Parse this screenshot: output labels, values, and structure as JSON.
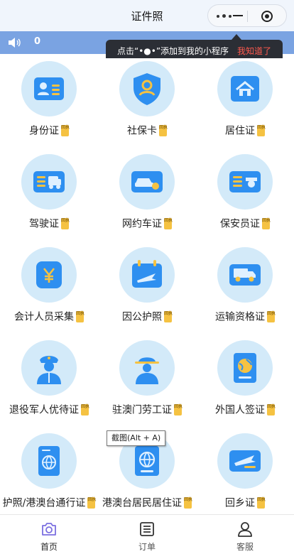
{
  "nav": {
    "title": "证件照"
  },
  "notice": {
    "count": "0"
  },
  "tooltip": {
    "message": "点击“•●•”添加到我的小程序",
    "dismiss": "我知道了"
  },
  "colors": {
    "accent": "#2e8ff0",
    "badge": "#f5c242",
    "notice_bar": "#7aa3e2",
    "icon_circle": "#d3eaf9"
  },
  "grid": {
    "items": [
      {
        "label": "身份证",
        "badge": "回执",
        "icon": "id-card-icon"
      },
      {
        "label": "社保卡",
        "badge": "回执",
        "icon": "shield-person-icon"
      },
      {
        "label": "居住证",
        "badge": "回执",
        "icon": "house-icon"
      },
      {
        "label": "驾驶证",
        "badge": "回执",
        "icon": "truck-license-icon"
      },
      {
        "label": "网约车证",
        "badge": "回执",
        "icon": "car-icon"
      },
      {
        "label": "保安员证",
        "badge": "回执",
        "icon": "guard-card-icon"
      },
      {
        "label": "会计人员采集",
        "badge": "回执",
        "icon": "yuan-icon"
      },
      {
        "label": "因公护照",
        "badge": "回执",
        "icon": "calendar-plane-icon"
      },
      {
        "label": "运输资格证",
        "badge": "回执",
        "icon": "delivery-truck-icon"
      },
      {
        "label": "退役军人优待证",
        "badge": "回执",
        "icon": "soldier-icon"
      },
      {
        "label": "驻澳门劳工证",
        "badge": "回执",
        "icon": "worker-helmet-icon"
      },
      {
        "label": "外国人签证",
        "badge": "回执",
        "icon": "globe-book-icon"
      },
      {
        "label": "护照/港澳台通行证",
        "badge": "回执",
        "icon": "passport-icon"
      },
      {
        "label": "港澳台居民居住证",
        "badge": "回执",
        "icon": "globe-passport-icon"
      },
      {
        "label": "回乡证",
        "badge": "回执",
        "icon": "plane-card-icon"
      }
    ]
  },
  "screenshot_hint": "截图(Alt + A)",
  "tabs": [
    {
      "label": "首页",
      "icon": "camera-icon"
    },
    {
      "label": "订单",
      "icon": "order-list-icon"
    },
    {
      "label": "客服",
      "icon": "person-icon"
    }
  ]
}
